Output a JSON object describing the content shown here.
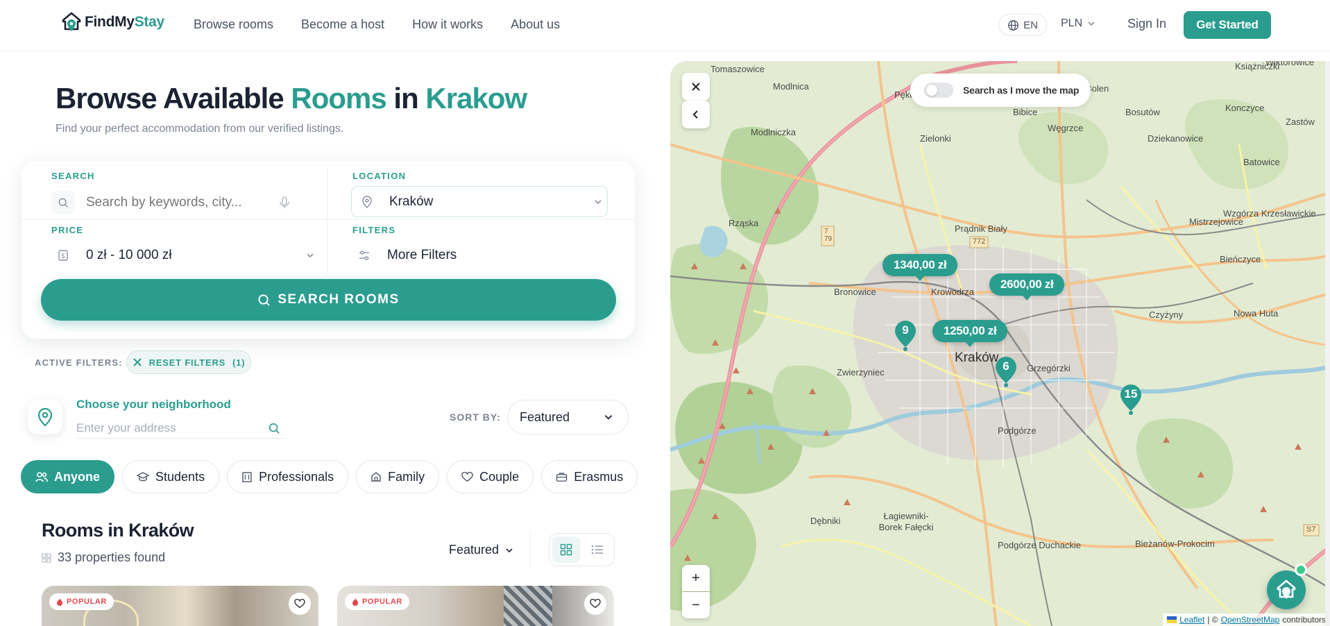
{
  "nav": {
    "logo_part1": "FindMy",
    "logo_part2": "Stay",
    "links": [
      "Browse rooms",
      "Become a host",
      "How it works",
      "About us"
    ],
    "language": "EN",
    "currency": "PLN",
    "sign_in": "Sign In",
    "get_started": "Get Started"
  },
  "heading": {
    "w1": "Browse Available ",
    "w2": "Rooms",
    "w3": " in ",
    "w4": "Krakow",
    "subtitle": "Find your perfect accommodation from our verified listings."
  },
  "search": {
    "search_label": "SEARCH",
    "search_placeholder": "Search by keywords, city...",
    "location_label": "LOCATION",
    "location_value": "Kraków",
    "price_label": "PRICE",
    "price_value": "0 zł - 10 000 zł",
    "filters_label": "FILTERS",
    "filters_value": "More Filters",
    "button": "SEARCH ROOMS"
  },
  "active_filters": {
    "label": "ACTIVE FILTERS:",
    "reset": "RESET FILTERS",
    "count": "(1)"
  },
  "neighborhood": {
    "title": "Choose your neighborhood",
    "placeholder": "Enter your address"
  },
  "sort": {
    "label": "SORT BY:",
    "value": "Featured"
  },
  "audience_pills": [
    {
      "label": "Anyone",
      "active": true
    },
    {
      "label": "Students",
      "active": false
    },
    {
      "label": "Professionals",
      "active": false
    },
    {
      "label": "Family",
      "active": false
    },
    {
      "label": "Couple",
      "active": false
    },
    {
      "label": "Erasmus",
      "active": false
    }
  ],
  "rooms": {
    "title": "Rooms in Kraków",
    "found": "33 properties found",
    "sort_value": "Featured",
    "cards": [
      {
        "badge": "POPULAR"
      },
      {
        "badge": "POPULAR"
      }
    ]
  },
  "map": {
    "toggle_label": "Search as I move the map",
    "zoom_in": "+",
    "zoom_out": "−",
    "price_tags": [
      "1340,00 zł",
      "2600,00 zł",
      "1250,00 zł"
    ],
    "clusters": [
      "9",
      "6",
      "15"
    ],
    "places": [
      "Tomaszowice",
      "Modlnica",
      "Pękowice",
      "Bolen",
      "Książniczki",
      "Wiktorowice",
      "Bibice",
      "Bosutów",
      "Konczyce",
      "Zastów",
      "Modlniczka",
      "Zielonki",
      "Węgrzce",
      "Dziekanowice",
      "Batowice",
      "Rząska",
      "Prądnik Biały",
      "Mistrzejowice",
      "Wzgórza Krzesławickie",
      "Bronowice",
      "Krowodrza",
      "Bieńczyce",
      "Czyżyny",
      "Nowa Huta",
      "Zwierzyniec",
      "Kraków",
      "Grzegórzki",
      "Podgórze",
      "Dębniki",
      "Łagiewniki-Borek Fałęcki",
      "Podgórze Duchackie",
      "Bieżanów-Prokocim"
    ],
    "attribution_leaflet": "Leaflet",
    "attribution_osm": "OpenStreetMap",
    "attribution_tail": "contributors"
  },
  "colors": {
    "brand": "#2a9d8f",
    "text": "#1b2333",
    "badge_red": "#e5484d"
  }
}
